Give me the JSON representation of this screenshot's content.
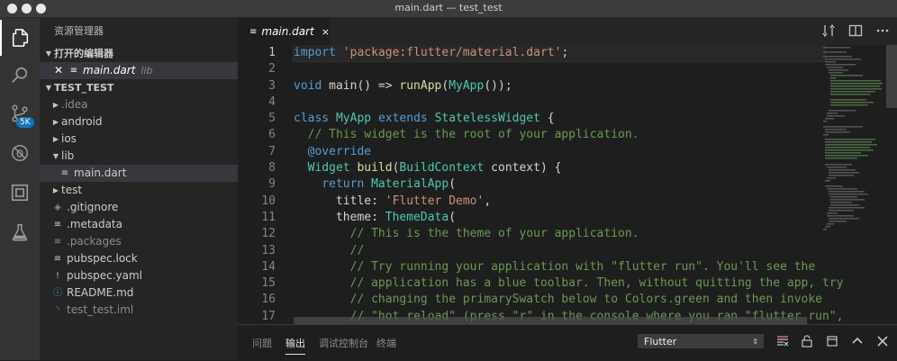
{
  "window": {
    "title": "main.dart — test_test"
  },
  "activity_bar": {
    "scm_badge": "5K"
  },
  "sidebar": {
    "title": "资源管理器",
    "open_editors_header": "打开的编辑器",
    "open_editor": {
      "name": "main.dart",
      "folder": "lib"
    },
    "project_header": "TEST_TEST",
    "tree": [
      {
        "label": ".idea",
        "kind": "folder",
        "expanded": false
      },
      {
        "label": "android",
        "kind": "folder",
        "expanded": false
      },
      {
        "label": "ios",
        "kind": "folder",
        "expanded": false
      },
      {
        "label": "lib",
        "kind": "folder",
        "expanded": true
      },
      {
        "label": "main.dart",
        "kind": "file"
      },
      {
        "label": "test",
        "kind": "folder",
        "expanded": false
      },
      {
        "label": ".gitignore",
        "kind": "file"
      },
      {
        "label": ".metadata",
        "kind": "file"
      },
      {
        "label": ".packages",
        "kind": "file"
      },
      {
        "label": "pubspec.lock",
        "kind": "file"
      },
      {
        "label": "pubspec.yaml",
        "kind": "file"
      },
      {
        "label": "README.md",
        "kind": "file"
      },
      {
        "label": "test_test.iml",
        "kind": "file"
      }
    ]
  },
  "tabs": [
    {
      "label": "main.dart",
      "close": "×"
    }
  ],
  "editor": {
    "line_numbers": [
      "1",
      "2",
      "3",
      "4",
      "5",
      "6",
      "7",
      "8",
      "9",
      "10",
      "11",
      "12",
      "13",
      "14",
      "15",
      "16",
      "17"
    ],
    "lines": [
      "import 'package:flutter/material.dart';",
      "",
      "void main() => runApp(MyApp());",
      "",
      "class MyApp extends StatelessWidget {",
      "  // This widget is the root of your application.",
      "  @override",
      "  Widget build(BuildContext context) {",
      "    return MaterialApp(",
      "      title: 'Flutter Demo',",
      "      theme: ThemeData(",
      "        // This is the theme of your application.",
      "        //",
      "        // Try running your application with \"flutter run\". You'll see the",
      "        // application has a blue toolbar. Then, without quitting the app, try",
      "        // changing the primarySwatch below to Colors.green and then invoke",
      "        // \"hot reload\" (press \"r\" in the console where you ran \"flutter run\","
    ]
  },
  "panel": {
    "tabs": [
      "问题",
      "输出",
      "调试控制台",
      "终端"
    ],
    "active_tab": "输出",
    "output_channel": "Flutter"
  },
  "colors": {
    "accent": "#1177bb",
    "keyword": "#569cd6",
    "string": "#ce9178",
    "comment": "#6a9955",
    "type": "#4ec9b0"
  }
}
